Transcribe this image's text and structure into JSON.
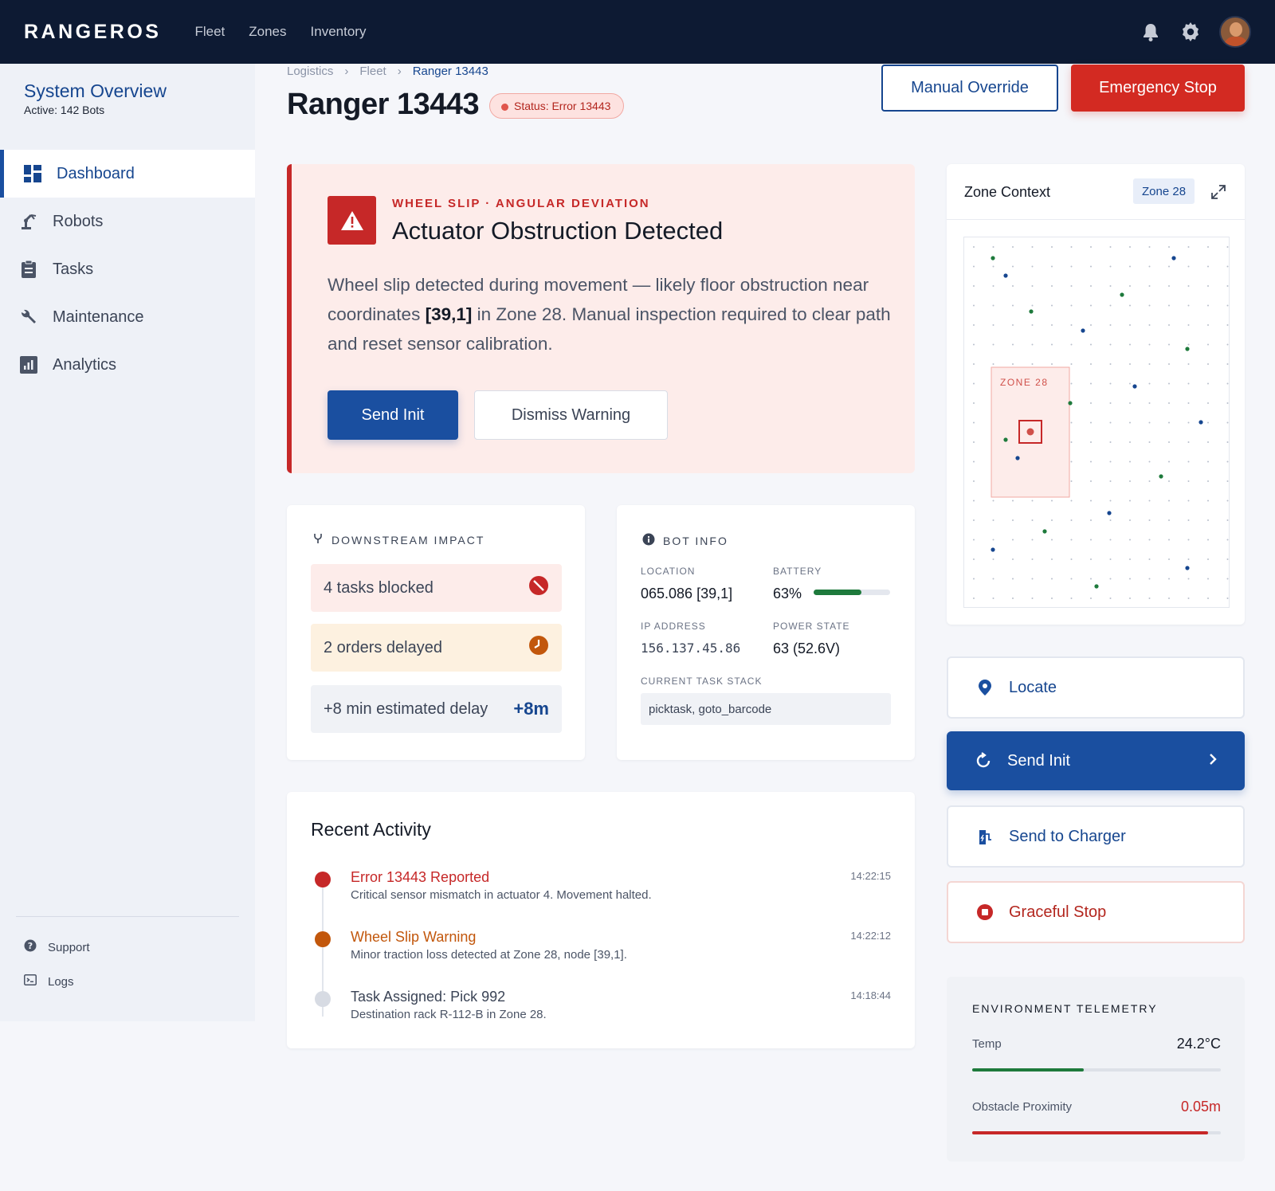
{
  "topbar": {
    "brand": "RANGEROS",
    "nav": [
      "Fleet",
      "Zones",
      "Inventory"
    ]
  },
  "sidebar": {
    "title": "System Overview",
    "subtitle": "Active: 142 Bots",
    "items": [
      {
        "label": "Dashboard",
        "icon": "dashboard-icon"
      },
      {
        "label": "Robots",
        "icon": "robot-arm-icon"
      },
      {
        "label": "Tasks",
        "icon": "clipboard-icon"
      },
      {
        "label": "Maintenance",
        "icon": "wrench-icon"
      },
      {
        "label": "Analytics",
        "icon": "bar-chart-icon"
      }
    ],
    "footer": [
      {
        "label": "Support",
        "icon": "help-icon"
      },
      {
        "label": "Logs",
        "icon": "terminal-icon"
      }
    ]
  },
  "header": {
    "breadcrumb": [
      "Logistics",
      "Fleet",
      "Ranger 13443"
    ],
    "title": "Ranger 13443",
    "status": "Status: Error 13443",
    "override_label": "Manual Override",
    "estop_label": "Emergency Stop"
  },
  "alert": {
    "kicker": "WHEEL SLIP · ANGULAR DEVIATION",
    "title": "Actuator Obstruction Detected",
    "body_pre": "Wheel slip detected during movement — likely floor obstruction near coordinates ",
    "body_coord": "[39,1]",
    "body_post": " in Zone 28. Manual inspection required to clear path and reset sensor calibration.",
    "primary_label": "Send Init",
    "secondary_label": "Dismiss Warning"
  },
  "impact": {
    "title": "DOWNSTREAM IMPACT",
    "rows": [
      {
        "label": "4 tasks blocked"
      },
      {
        "label": "2 orders delayed"
      },
      {
        "label": "+8 min estimated delay",
        "value": "+8m"
      }
    ]
  },
  "bot_info": {
    "title": "BOT INFO",
    "location_label": "LOCATION",
    "location": "065.086 [39,1]",
    "battery_label": "BATTERY",
    "battery": "63%",
    "battery_level": 0.63,
    "ip_label": "IP ADDRESS",
    "ip": "156.137.45.86",
    "power_label": "POWER STATE",
    "power": "63 (52.6V)",
    "task_label": "CURRENT TASK STACK",
    "task_stack": "picktask, goto_barcode"
  },
  "activity": {
    "title": "Recent Activity",
    "items": [
      {
        "title": "Error 13443 Reported",
        "desc": "Critical sensor mismatch in actuator 4. Movement halted.",
        "time": "14:22:15",
        "color": "#c62828"
      },
      {
        "title": "Wheel Slip Warning",
        "desc": "Minor traction loss detected at Zone 28, node [39,1].",
        "time": "14:22:12",
        "color": "#c2570c"
      },
      {
        "title": "Task Assigned: Pick 992",
        "desc": "Destination rack R-112-B in Zone 28.",
        "time": "14:18:44",
        "color": "#d7dbe3"
      }
    ]
  },
  "zone": {
    "title": "Zone Context",
    "tag": "Zone 28",
    "map_label": "ZONE 28"
  },
  "actions": {
    "locate": "Locate",
    "send_init": "Send Init",
    "charger": "Send to Charger",
    "graceful": "Graceful Stop"
  },
  "telemetry": {
    "title": "ENVIRONMENT TELEMETRY",
    "temp_label": "Temp",
    "temp": "24.2°C",
    "temp_level": 0.45,
    "prox_label": "Obstacle Proximity",
    "prox": "0.05m",
    "prox_level": 0.95
  },
  "colors": {
    "brand": "#1a4fa0",
    "danger": "#c62828",
    "warning": "#c2570c",
    "success": "#1e7a3c",
    "navbar": "#0d1a33"
  }
}
